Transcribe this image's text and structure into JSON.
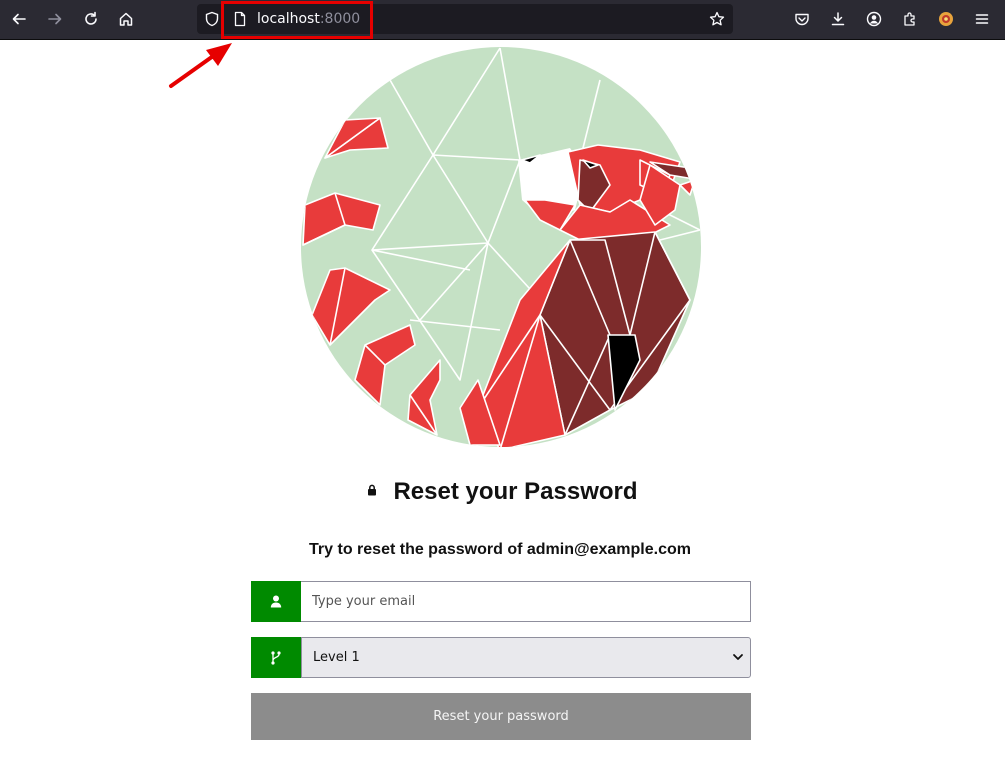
{
  "browser": {
    "url_host": "localhost",
    "url_port": ":8000"
  },
  "page": {
    "title": "Reset your Password",
    "subtitle": "Try to reset the password of admin@example.com",
    "email_placeholder": "Type your email",
    "level_selected": "Level 1",
    "submit_label": "Reset your password"
  },
  "colors": {
    "accent_green": "#008a00",
    "annotation_red": "#e60000",
    "logo_green": "#c5e1c5",
    "logo_red": "#e83b3b",
    "logo_dark_red": "#7d2b2b"
  },
  "icons": [
    "back-arrow-icon",
    "forward-arrow-icon",
    "reload-icon",
    "home-icon",
    "shield-icon",
    "page-icon",
    "star-icon",
    "pocket-icon",
    "download-icon",
    "account-icon",
    "extensions-icon",
    "extension-badge-icon",
    "menu-icon",
    "lock-icon",
    "user-icon",
    "branch-icon",
    "chevron-down-icon"
  ]
}
